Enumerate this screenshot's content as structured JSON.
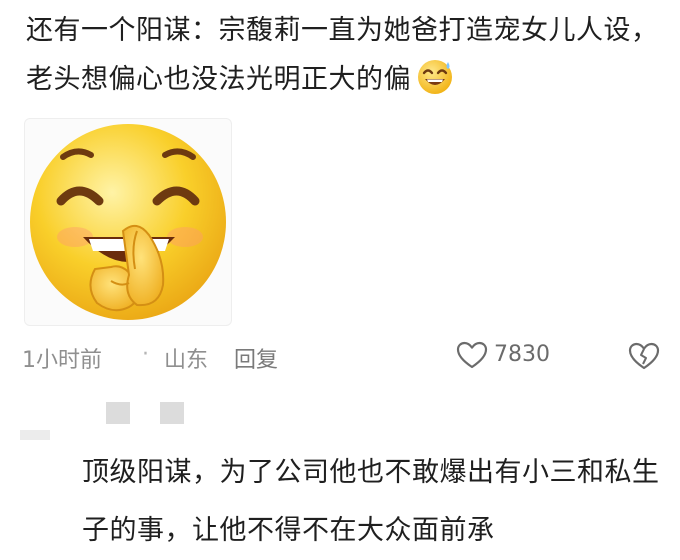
{
  "comment": {
    "text": "还有一个阳谋：宗馥莉一直为她爸打造宠女儿人设，老头想偏心也没法光明正大的偏",
    "inline_emoji": "grinning-sweat-emoji",
    "sticker": "shy-giggle-emoji-sticker"
  },
  "meta": {
    "time": "1小时前",
    "separator": "·",
    "location": "山东",
    "reply_label": "回复",
    "like_count": "7830",
    "like_icon": "heart-outline-icon",
    "dislike_icon": "broken-heart-icon"
  },
  "reply": {
    "avatar": "blurred-avatar",
    "text": "顶级阳谋，为了公司他也不敢爆出有小三和私生子的事，让他不得不在大众面前承"
  },
  "colors": {
    "text": "#1f1f1f",
    "meta": "#8f8f8f",
    "emoji_yellow": "#f8c81c",
    "emoji_dark": "#6e3a10"
  }
}
